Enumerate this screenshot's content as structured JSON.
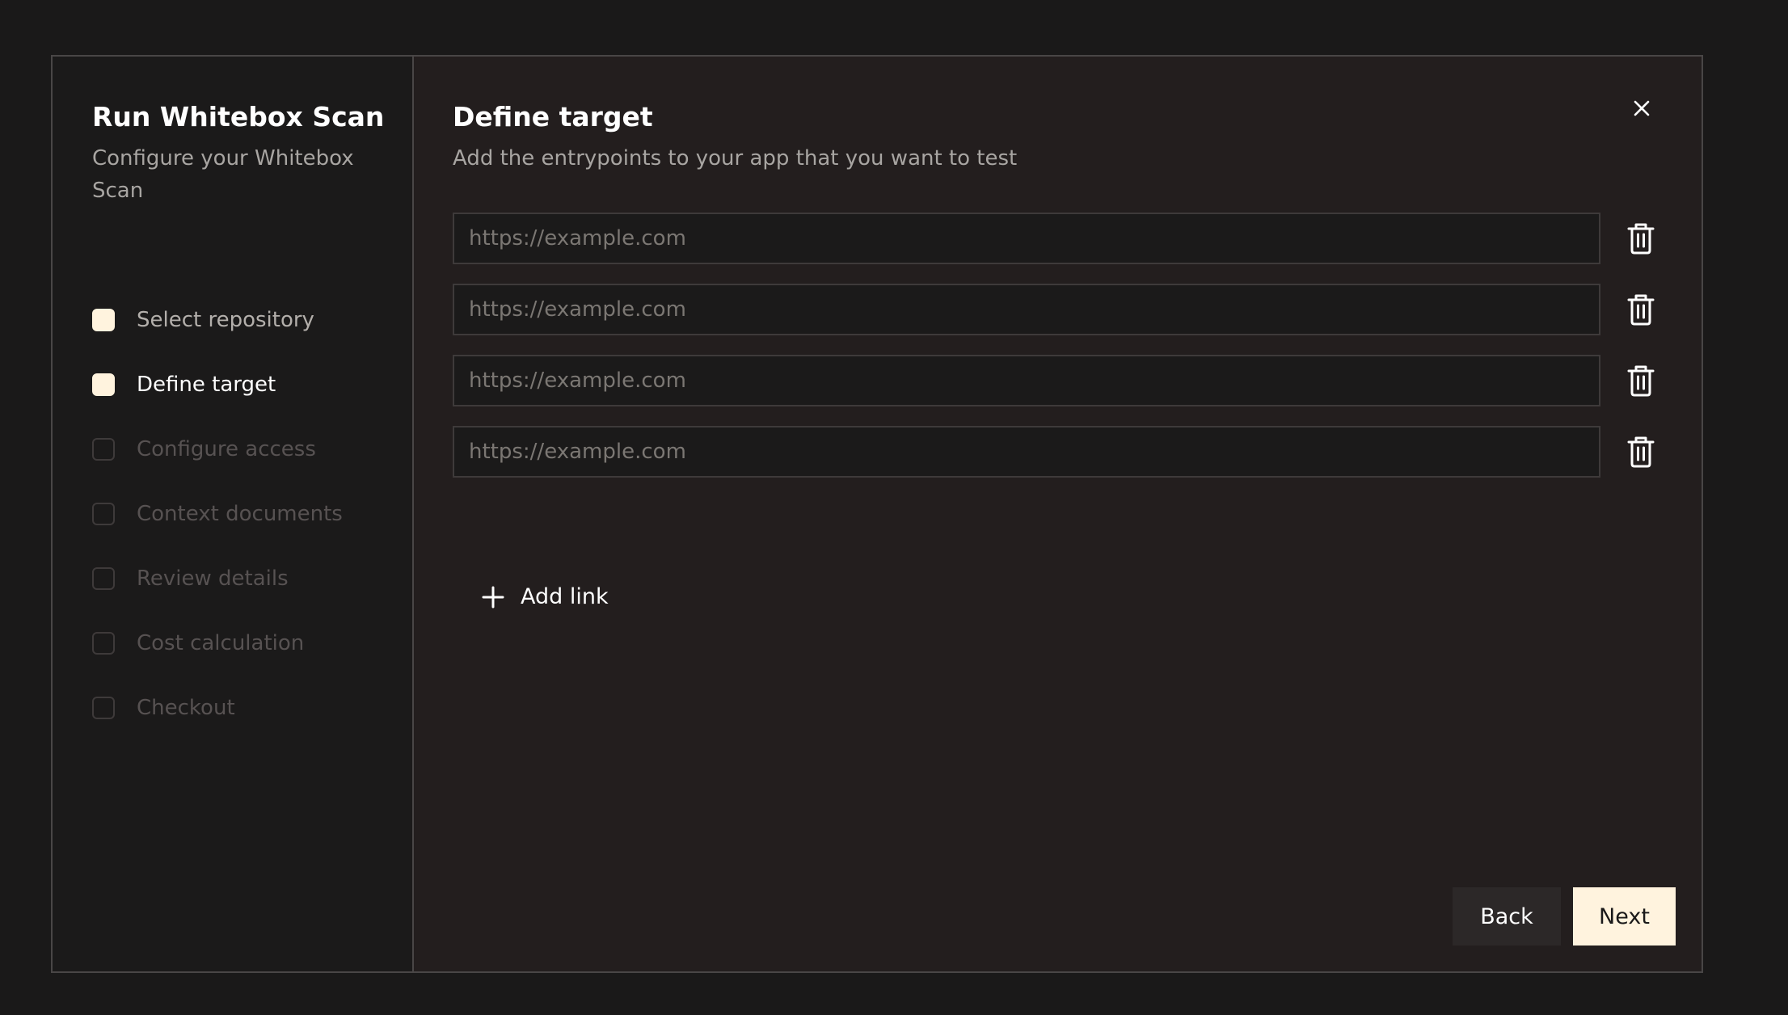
{
  "sidebar": {
    "title": "Run Whitebox Scan",
    "subtitle": "Configure your Whitebox Scan",
    "steps": [
      {
        "label": "Select repository",
        "state": "done"
      },
      {
        "label": "Define target",
        "state": "active"
      },
      {
        "label": "Configure access",
        "state": "pending"
      },
      {
        "label": "Context documents",
        "state": "pending"
      },
      {
        "label": "Review details",
        "state": "pending"
      },
      {
        "label": "Cost calculation",
        "state": "pending"
      },
      {
        "label": "Checkout",
        "state": "pending"
      }
    ]
  },
  "main": {
    "title": "Define target",
    "subtitle": "Add the entrypoints to your app that you want to test",
    "close_icon": "close-icon",
    "links": [
      {
        "value": "",
        "placeholder": "https://example.com",
        "delete_icon": "trash-icon"
      },
      {
        "value": "",
        "placeholder": "https://example.com",
        "delete_icon": "trash-icon"
      },
      {
        "value": "",
        "placeholder": "https://example.com",
        "delete_icon": "trash-icon"
      },
      {
        "value": "",
        "placeholder": "https://example.com",
        "delete_icon": "trash-icon"
      }
    ],
    "add_link_label": "Add link",
    "add_link_icon": "plus-icon"
  },
  "footer": {
    "back_label": "Back",
    "next_label": "Next"
  },
  "colors": {
    "background": "#1a1919",
    "panel": "#231e1e",
    "sidebar": "#1b1a1a",
    "border": "#494646",
    "accent": "#fff3de",
    "text": "#ffffff",
    "muted_text": "#a8a5a2"
  }
}
